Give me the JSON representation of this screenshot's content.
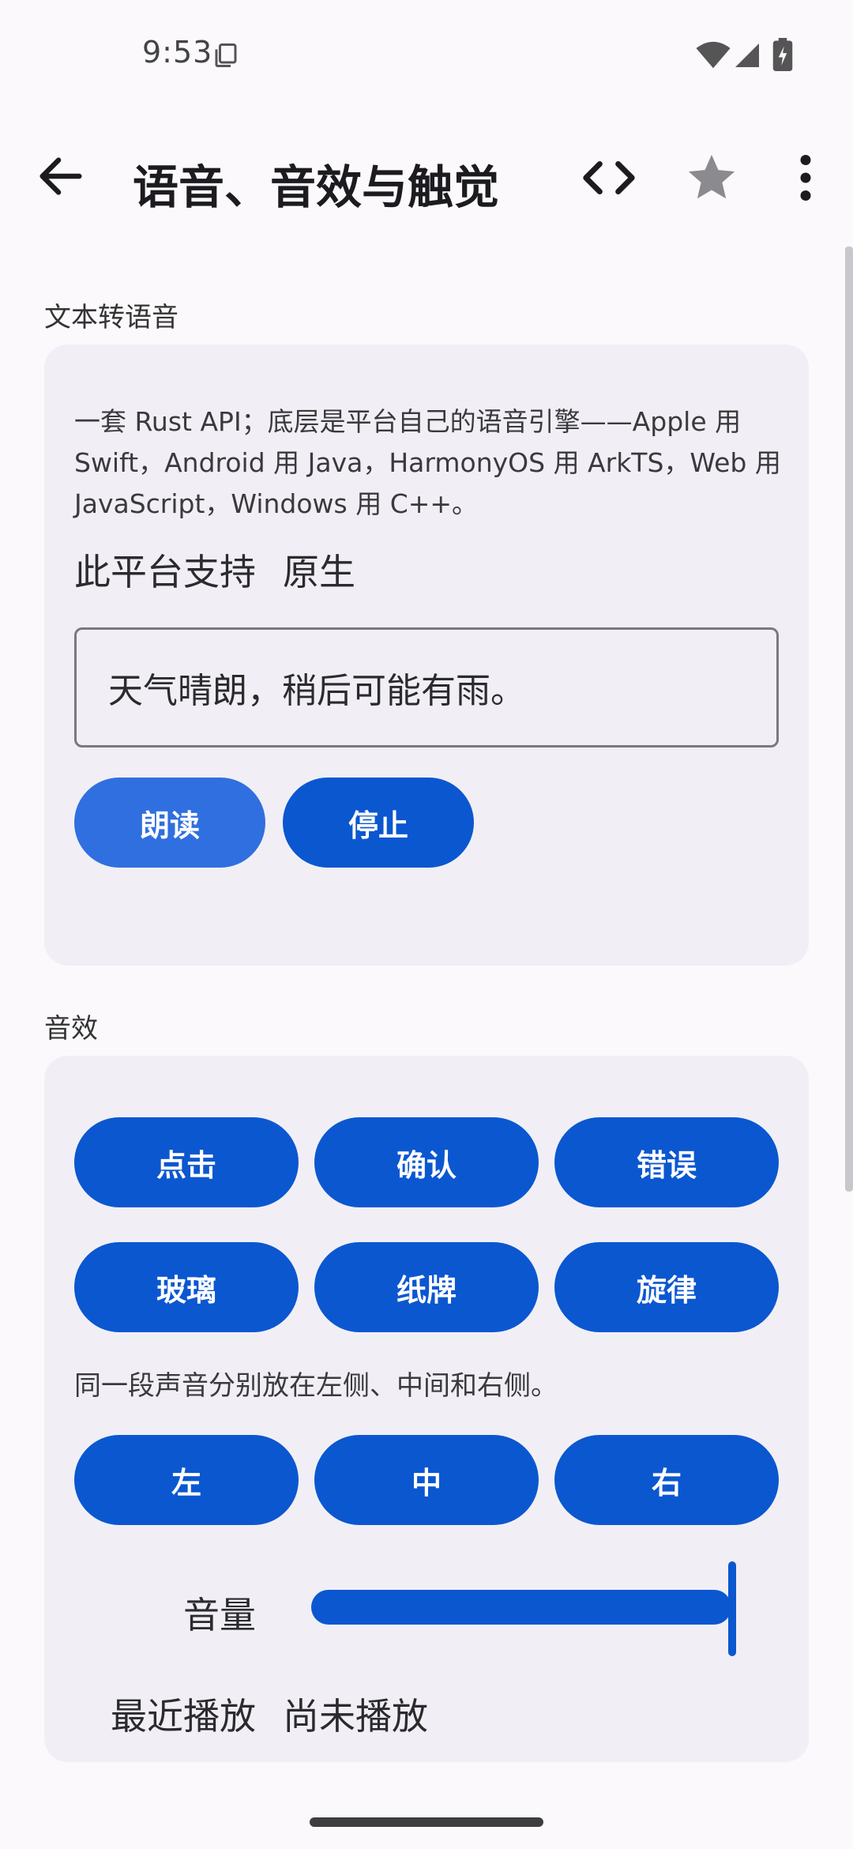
{
  "status_bar": {
    "time": "9:53",
    "icons": [
      "copy-icon",
      "wifi-icon",
      "signal-icon",
      "battery-charging-icon"
    ]
  },
  "app_bar": {
    "title": "语音、音效与触觉",
    "actions": [
      "back-arrow-icon",
      "code-icon",
      "star-icon",
      "more-vert-icon"
    ]
  },
  "tts": {
    "header": "文本转语音",
    "description": "一套 Rust API；底层是平台自己的语音引擎——Apple 用 Swift，Android 用 Java，HarmonyOS 用 ArkTS，Web 用 JavaScript，Windows 用 C++。",
    "support_label": "此平台支持",
    "support_value": "原生",
    "input_value": "天气晴朗，稍后可能有雨。",
    "read_button": "朗读",
    "stop_button": "停止"
  },
  "sfx": {
    "header": "音效",
    "buttons_row1": [
      "点击",
      "确认",
      "错误"
    ],
    "buttons_row2": [
      "玻璃",
      "纸牌",
      "旋律"
    ],
    "helper": "同一段声音分别放在左侧、中间和右侧。",
    "pan_buttons": [
      "左",
      "中",
      "右"
    ],
    "volume_label": "音量",
    "volume_fraction": 1.0,
    "recent_label": "最近播放",
    "recent_value": "尚未播放"
  },
  "colors": {
    "primary": "#0b57d0",
    "primary_light": "#306fe0",
    "card": "#f1eff5",
    "background": "#fbf9fc"
  }
}
